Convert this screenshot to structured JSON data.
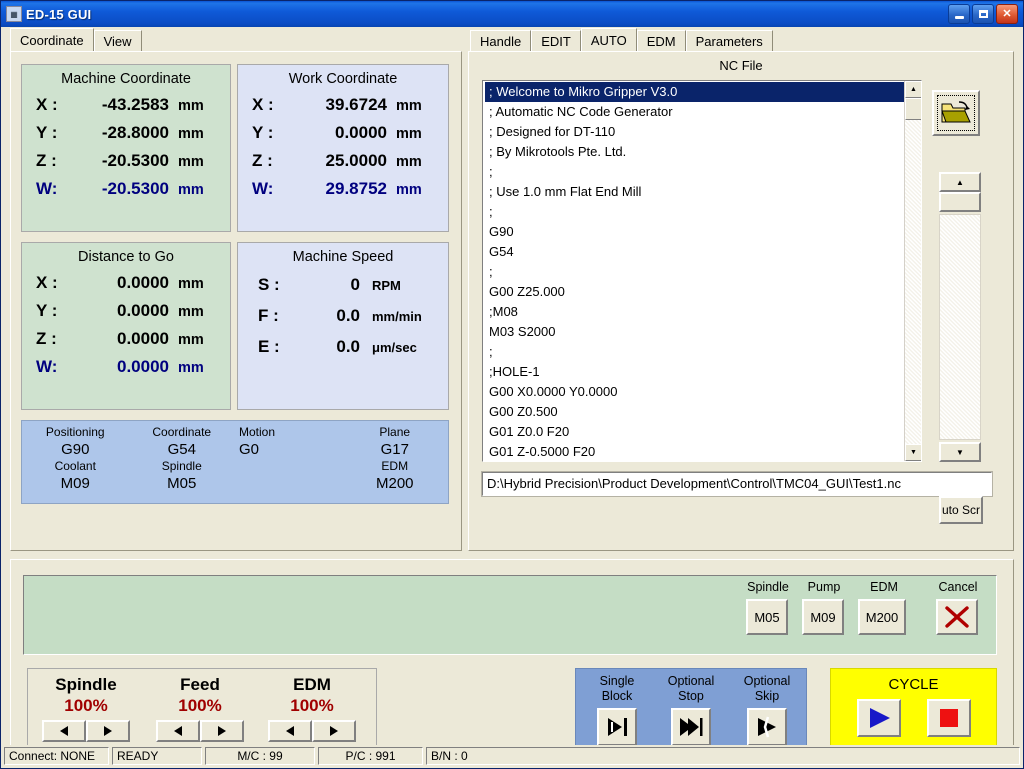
{
  "window": {
    "title": "ED-15 GUI",
    "icon": "app-icon",
    "minimize_label": "_",
    "maximize_label": "▢",
    "close_label": "✕"
  },
  "left_tabs": [
    {
      "label": "Coordinate",
      "active": true
    },
    {
      "label": "View",
      "active": false
    }
  ],
  "right_tabs": [
    {
      "label": "Handle",
      "active": false
    },
    {
      "label": "EDIT",
      "active": false
    },
    {
      "label": "AUTO",
      "active": true
    },
    {
      "label": "EDM",
      "active": false
    },
    {
      "label": "Parameters",
      "active": false
    }
  ],
  "machine_coordinate": {
    "title": "Machine Coordinate",
    "rows": [
      {
        "axis": "X :",
        "value": "-43.2583",
        "unit": "mm"
      },
      {
        "axis": "Y :",
        "value": "-28.8000",
        "unit": "mm"
      },
      {
        "axis": "Z :",
        "value": "-20.5300",
        "unit": "mm"
      },
      {
        "axis": "W:",
        "value": "-20.5300",
        "unit": "mm"
      }
    ]
  },
  "work_coordinate": {
    "title": "Work Coordinate",
    "rows": [
      {
        "axis": "X :",
        "value": "39.6724",
        "unit": "mm"
      },
      {
        "axis": "Y :",
        "value": "0.0000",
        "unit": "mm"
      },
      {
        "axis": "Z :",
        "value": "25.0000",
        "unit": "mm"
      },
      {
        "axis": "W:",
        "value": "29.8752",
        "unit": "mm"
      }
    ]
  },
  "distance_to_go": {
    "title": "Distance to Go",
    "rows": [
      {
        "axis": "X :",
        "value": "0.0000",
        "unit": "mm"
      },
      {
        "axis": "Y :",
        "value": "0.0000",
        "unit": "mm"
      },
      {
        "axis": "Z :",
        "value": "0.0000",
        "unit": "mm"
      },
      {
        "axis": "W:",
        "value": "0.0000",
        "unit": "mm"
      }
    ]
  },
  "machine_speed": {
    "title": "Machine Speed",
    "rows": [
      {
        "axis": "S :",
        "value": "0",
        "unit": "RPM"
      },
      {
        "axis": "F :",
        "value": "0.0",
        "unit": "mm/min"
      },
      {
        "axis": "E :",
        "value": "0.0",
        "unit": "μm/sec"
      }
    ]
  },
  "modal_state": [
    {
      "label": "Positioning",
      "value": "G90"
    },
    {
      "label": "Coordinate",
      "value": "G54"
    },
    {
      "label": "Motion",
      "value": "G0"
    },
    {
      "label": "Plane",
      "value": "G17"
    },
    {
      "label": "Coolant",
      "value": "M09"
    },
    {
      "label": "Spindle",
      "value": "M05"
    },
    {
      "label": "",
      "value": ""
    },
    {
      "label": "EDM",
      "value": "M200"
    }
  ],
  "nc_file": {
    "label": "NC File",
    "path": "D:\\Hybrid Precision\\Product Development\\Control\\TMC04_GUI\\Test1.nc",
    "lines": [
      "; Welcome to Mikro Gripper V3.0",
      "; Automatic NC Code Generator",
      "; Designed for DT-110",
      "; By Mikrotools Pte. Ltd.",
      ";",
      "; Use 1.0 mm Flat End Mill",
      ";",
      "G90",
      "G54",
      ";",
      "G00 Z25.000",
      ";M08",
      "M03 S2000",
      ";",
      ";HOLE-1",
      "G00 X0.0000 Y0.0000",
      "G00 Z0.500",
      "G01 Z0.0 F20",
      "G01 Z-0.5000 F20"
    ],
    "selected_index": 0,
    "open_button": "folder-open-icon",
    "auto_scroll_label": "uto Scr",
    "scroll_up": "▲",
    "scroll_down": "▼"
  },
  "message_panel": {
    "text": ""
  },
  "output_controls": [
    {
      "label": "Spindle",
      "value": "M05"
    },
    {
      "label": "Pump",
      "value": "M09"
    },
    {
      "label": "EDM",
      "value": "M200"
    },
    {
      "label": "Cancel",
      "value": "✕"
    }
  ],
  "overrides": [
    {
      "name": "Spindle",
      "percent": "100%",
      "dec": "◀",
      "inc": "▶"
    },
    {
      "name": "Feed",
      "percent": "100%",
      "dec": "◀",
      "inc": "▶"
    },
    {
      "name": "EDM",
      "percent": "100%",
      "dec": "◀",
      "inc": "▶"
    }
  ],
  "block_controls": [
    {
      "line1": "Single",
      "line2": "Block"
    },
    {
      "line1": "Optional",
      "line2": "Stop"
    },
    {
      "line1": "Optional",
      "line2": "Skip"
    }
  ],
  "cycle": {
    "title": "CYCLE",
    "start": "cycle-start-icon",
    "stop": "cycle-stop-icon"
  },
  "statusbar": [
    {
      "text": "Connect: NONE"
    },
    {
      "text": "READY"
    },
    {
      "text": "M/C : 99"
    },
    {
      "text": "P/C : 991"
    },
    {
      "text": "B/N : 0"
    }
  ],
  "colors": {
    "titlebar": "#0b4cc4",
    "green_panel": "#cfe2cf",
    "blue_panel": "#dde3f5",
    "state_panel": "#aec6ea",
    "message_panel": "#c5ddc5",
    "block_panel": "#7f9fd4",
    "cycle_panel": "#ffff00",
    "override_value": "#a00000",
    "w_axis": "#00007f",
    "selection": "#0a246a"
  }
}
